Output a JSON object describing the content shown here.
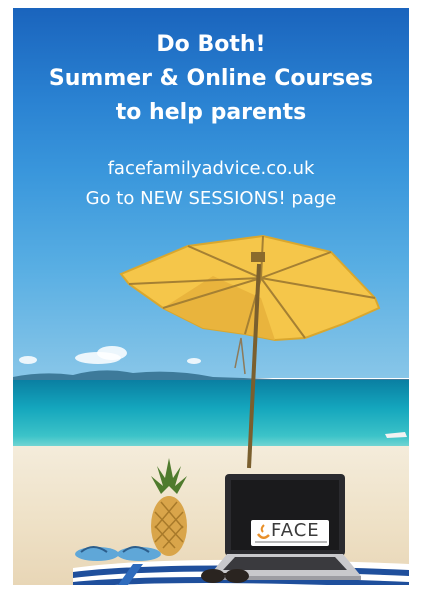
{
  "headline": {
    "line1": "Do Both!",
    "line2": "Summer & Online Courses",
    "line3": "to help parents"
  },
  "subtext": {
    "line1": "facefamilyadvice.co.uk",
    "line2": "Go to NEW SESSIONS! page"
  },
  "laptop_logo": {
    "word": "FACE"
  },
  "colors": {
    "sky_top": "#1a64bd",
    "umbrella": "#f5c64a",
    "sea": "#14a6bd",
    "sand": "#efe2c8",
    "logo_accent": "#e8902a"
  }
}
